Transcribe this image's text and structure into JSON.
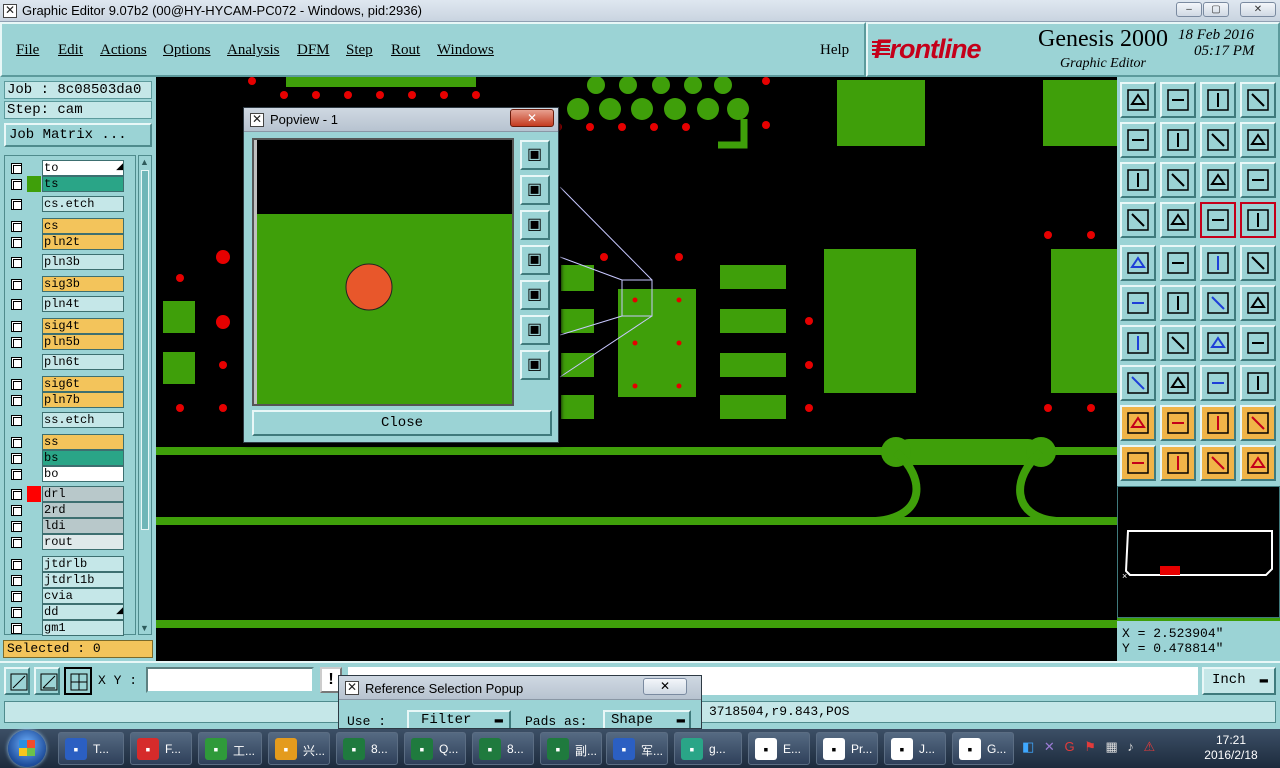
{
  "window": {
    "title": "Graphic Editor 9.07b2 (00@HY-HYCAM-PC072 - Windows, pid:2936)"
  },
  "menu": {
    "items": [
      "File",
      "Edit",
      "Actions",
      "Options",
      "Analysis",
      "DFM",
      "Step",
      "Rout",
      "Windows"
    ],
    "help": "Help"
  },
  "brand": {
    "logo": "Frontline",
    "product": "Genesis 2000",
    "subtitle": "Graphic Editor",
    "date": "18 Feb 2016",
    "time": "05:17 PM"
  },
  "job": {
    "label": "Job : 8c08503da0",
    "step": "Step: cam",
    "matrix_button": "Job Matrix ..."
  },
  "layers": [
    {
      "name": "to",
      "bg": "#ffffff",
      "aff": ""
    },
    {
      "name": "ts",
      "bg": "#2aa587",
      "aff": "#3f9f0a"
    },
    {
      "name": "cs.etch",
      "bg": "#c5e7e8",
      "aff": ""
    },
    {
      "name": "cs",
      "bg": "#f3c45b",
      "aff": ""
    },
    {
      "name": "pln2t",
      "bg": "#f3c45b",
      "aff": ""
    },
    {
      "name": "pln3b",
      "bg": "#c5e7e8",
      "aff": ""
    },
    {
      "name": "sig3b",
      "bg": "#f3c45b",
      "aff": ""
    },
    {
      "name": "pln4t",
      "bg": "#c5e7e8",
      "aff": ""
    },
    {
      "name": "sig4t",
      "bg": "#f3c45b",
      "aff": ""
    },
    {
      "name": "pln5b",
      "bg": "#f3c45b",
      "aff": ""
    },
    {
      "name": "pln6t",
      "bg": "#c5e7e8",
      "aff": ""
    },
    {
      "name": "sig6t",
      "bg": "#f3c45b",
      "aff": ""
    },
    {
      "name": "pln7b",
      "bg": "#f3c45b",
      "aff": ""
    },
    {
      "name": "ss.etch",
      "bg": "#c5e7e8",
      "aff": ""
    },
    {
      "name": "ss",
      "bg": "#f3c45b",
      "aff": ""
    },
    {
      "name": "bs",
      "bg": "#2aa587",
      "aff": ""
    },
    {
      "name": "bo",
      "bg": "#ffffff",
      "aff": ""
    },
    {
      "name": "drl",
      "bg": "#b8c8ca",
      "aff": "#ff0000"
    },
    {
      "name": "2rd",
      "bg": "#b8c8ca",
      "aff": ""
    },
    {
      "name": "ldi",
      "bg": "#b8c8ca",
      "aff": ""
    },
    {
      "name": "rout",
      "bg": "#dfe9ea",
      "aff": ""
    },
    {
      "name": "jtdrlb",
      "bg": "#c5e7e8",
      "aff": ""
    },
    {
      "name": "jtdrl1b",
      "bg": "#c5e7e8",
      "aff": ""
    },
    {
      "name": "cvia",
      "bg": "#c5e7e8",
      "aff": ""
    },
    {
      "name": "dd",
      "bg": "#c5e7e8",
      "aff": ""
    },
    {
      "name": "gm1",
      "bg": "#c5e7e8",
      "aff": ""
    }
  ],
  "selected": "Selected : 0",
  "coords": {
    "x": "X = 2.523904\"",
    "y": "Y = 0.478814\""
  },
  "xy": {
    "label": "X Y :",
    "value": ""
  },
  "units": "Inch",
  "status": "3718504,r9.843,POS",
  "popview": {
    "title": "Popview - 1",
    "close": "Close"
  },
  "ref_popup": {
    "title": "Reference Selection Popup",
    "use_label": "Use  :",
    "use_value": "Filter",
    "pads_label": "Pads as:",
    "pads_value": "Shape"
  },
  "taskbar": {
    "items": [
      {
        "label": "T...",
        "icon": "save-icon",
        "color": "#2b5fc2"
      },
      {
        "label": "F...",
        "icon": "g-logo-icon",
        "color": "#d62b2b"
      },
      {
        "label": "工...",
        "icon": "f-logo-icon",
        "color": "#2f9a3a"
      },
      {
        "label": "兴...",
        "icon": "shell-icon",
        "color": "#e49b1d"
      },
      {
        "label": "8...",
        "icon": "excel-icon",
        "color": "#1f7a3e"
      },
      {
        "label": "Q...",
        "icon": "excel-icon",
        "color": "#1f7a3e"
      },
      {
        "label": "8...",
        "icon": "excel-icon",
        "color": "#1f7a3e"
      },
      {
        "label": "副...",
        "icon": "excel-icon",
        "color": "#1f7a3e"
      },
      {
        "label": "军...",
        "icon": "word-icon",
        "color": "#2b5fc2"
      },
      {
        "label": "g...",
        "icon": "genesis-icon",
        "color": "#2aa587"
      },
      {
        "label": "E...",
        "icon": "x-window-icon",
        "color": "#ffffff"
      },
      {
        "label": "Pr...",
        "icon": "x-window-icon",
        "color": "#ffffff"
      },
      {
        "label": "J...",
        "icon": "x-window-icon",
        "color": "#ffffff"
      },
      {
        "label": "G...",
        "icon": "x-window-icon",
        "color": "#ffffff"
      }
    ],
    "clock_time": "17:21",
    "clock_date": "2016/2/18"
  },
  "colors": {
    "copper": "#3f9f0a",
    "drill": "#e60000",
    "panel": "#9bd3d5",
    "orange": "#f3c45b"
  }
}
